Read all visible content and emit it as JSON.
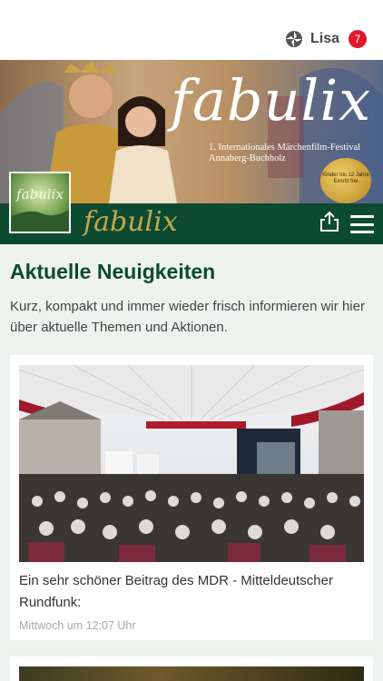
{
  "header": {
    "user_name": "Lisa",
    "notification_count": "7"
  },
  "hero": {
    "brand": "fabulix",
    "subtitle_line1": "1. Internationales Märchenfilm-Festival",
    "subtitle_line2": "Annaberg-Buchholz",
    "seal_text": "Kinder bis 12 Jahre Eintritt frei"
  },
  "navbar": {
    "brand": "fabulix"
  },
  "main": {
    "title": "Aktuelle Neuigkeiten",
    "intro": "Kurz, kompakt und immer wieder frisch informieren wir hier über aktuelle Themen und Aktionen."
  },
  "posts": [
    {
      "text": "Ein sehr schöner Beitrag des MDR - Mitteldeutscher Rundfunk:",
      "time": "Mittwoch um 12:07 Uhr"
    }
  ],
  "colors": {
    "brand_green": "#0c4a32",
    "gold": "#c7a64c",
    "badge_red": "#e0182b"
  }
}
